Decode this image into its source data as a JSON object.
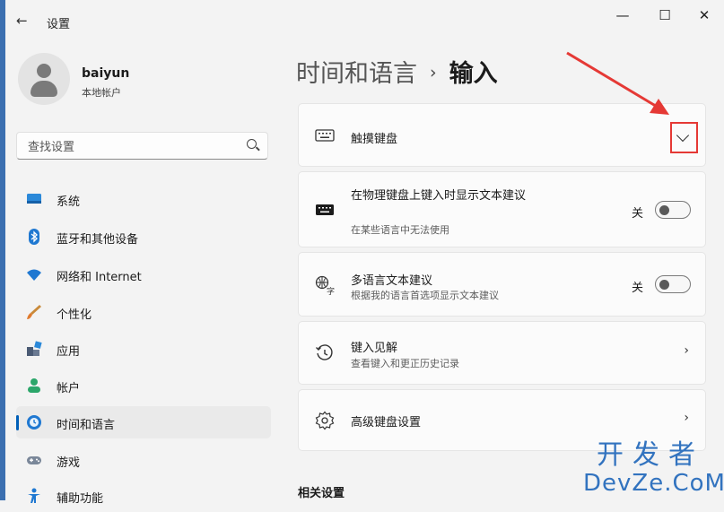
{
  "window": {
    "title": "设置",
    "back_glyph": "←",
    "controls": {
      "minimize": "—",
      "maximize": "☐",
      "close": "✕"
    }
  },
  "user": {
    "name": "baiyun",
    "type": "本地帐户"
  },
  "search": {
    "placeholder": "查找设置"
  },
  "sidebar": {
    "items": [
      {
        "label": "系统",
        "icon": "system-icon"
      },
      {
        "label": "蓝牙和其他设备",
        "icon": "bluetooth-icon"
      },
      {
        "label": "网络和 Internet",
        "icon": "wifi-icon"
      },
      {
        "label": "个性化",
        "icon": "brush-icon"
      },
      {
        "label": "应用",
        "icon": "apps-icon"
      },
      {
        "label": "帐户",
        "icon": "account-icon"
      },
      {
        "label": "时间和语言",
        "icon": "time-language-icon",
        "active": true
      },
      {
        "label": "游戏",
        "icon": "gamepad-icon"
      },
      {
        "label": "辅助功能",
        "icon": "accessibility-icon"
      }
    ]
  },
  "breadcrumb": {
    "parent": "时间和语言",
    "separator": "›",
    "current": "输入"
  },
  "cards": {
    "touch_keyboard": {
      "title": "触摸键盘",
      "icon": "keyboard-icon",
      "expand": "chevron-down-icon"
    },
    "physical_suggestions": {
      "title": "在物理键盘上键入时显示文本建议",
      "subtitle": "在某些语言中无法使用",
      "state_label": "关",
      "enabled": false,
      "icon": "keyboard-filled-icon"
    },
    "multilingual": {
      "title": "多语言文本建议",
      "subtitle": "根据我的语言首选项显示文本建议",
      "state_label": "关",
      "enabled": false,
      "icon": "language-icon"
    },
    "typing_insights": {
      "title": "键入见解",
      "subtitle": "查看键入和更正历史记录",
      "chevron": "›",
      "icon": "history-icon"
    },
    "advanced_keyboard": {
      "title": "高级键盘设置",
      "chevron": "›",
      "icon": "gear-icon"
    }
  },
  "related": {
    "heading": "相关设置"
  },
  "watermark": {
    "line1": "开发者",
    "line2": "DevZe.CoM"
  },
  "colors": {
    "accent": "#005fb8",
    "annotation": "#e53935",
    "watermark": "#3273bf"
  }
}
